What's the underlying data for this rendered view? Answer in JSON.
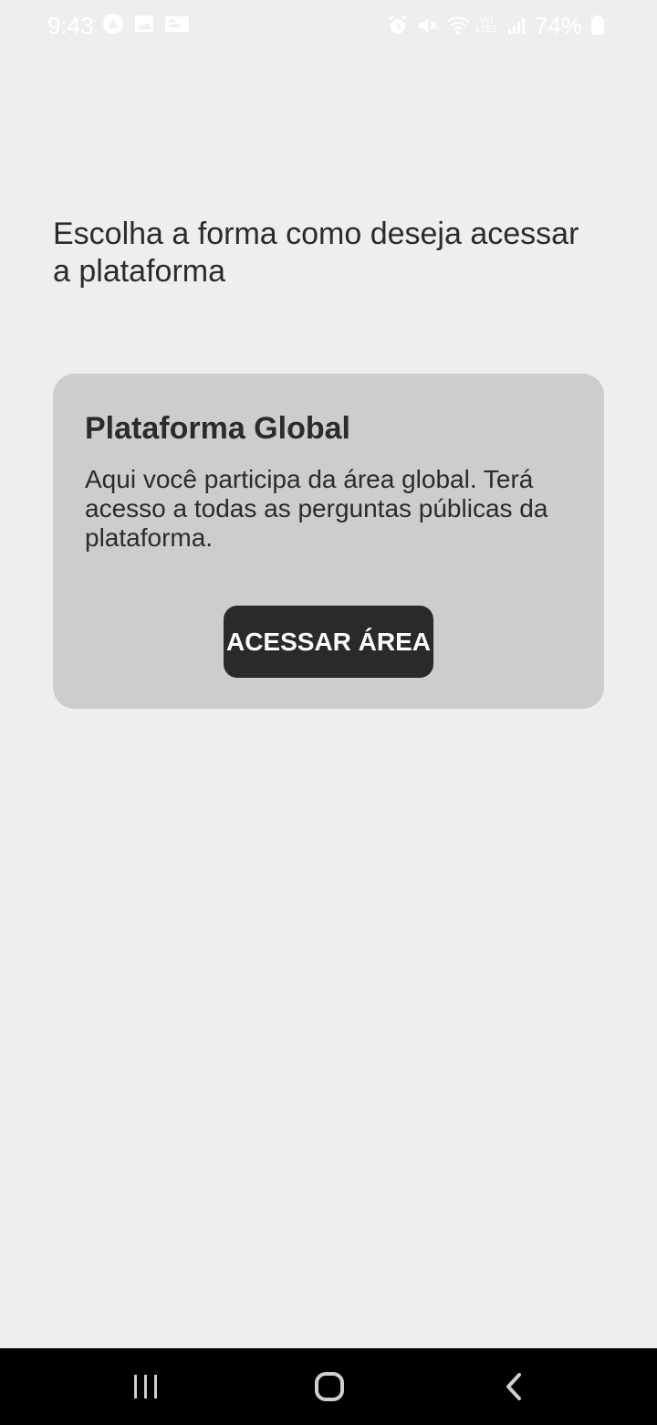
{
  "status_bar": {
    "time": "9:43",
    "left_icons": [
      "vpn-icon",
      "image-icon",
      "notification-icon"
    ],
    "network_label": "Vo)\nLTE1",
    "battery": "74%",
    "right_icons": [
      "alarm-icon",
      "mute-icon",
      "wifi-icon",
      "signal-icon",
      "battery-icon"
    ]
  },
  "screen": {
    "title": "Escolha a forma como deseja acessar a plataforma"
  },
  "platform_card": {
    "title": "Plataforma Global",
    "description": "Aqui você participa da área global. Terá acesso a todas as perguntas públicas da plataforma.",
    "button_label": "ACESSAR ÁREA"
  },
  "navigation": {
    "items": [
      "recent-apps-icon",
      "home-icon",
      "back-icon"
    ]
  },
  "colors": {
    "background": "#eeeeee",
    "card_background": "#cdcdcd",
    "button_background": "#2a2a2a",
    "text": "#2b2b2b",
    "navigation_background": "#000000"
  }
}
